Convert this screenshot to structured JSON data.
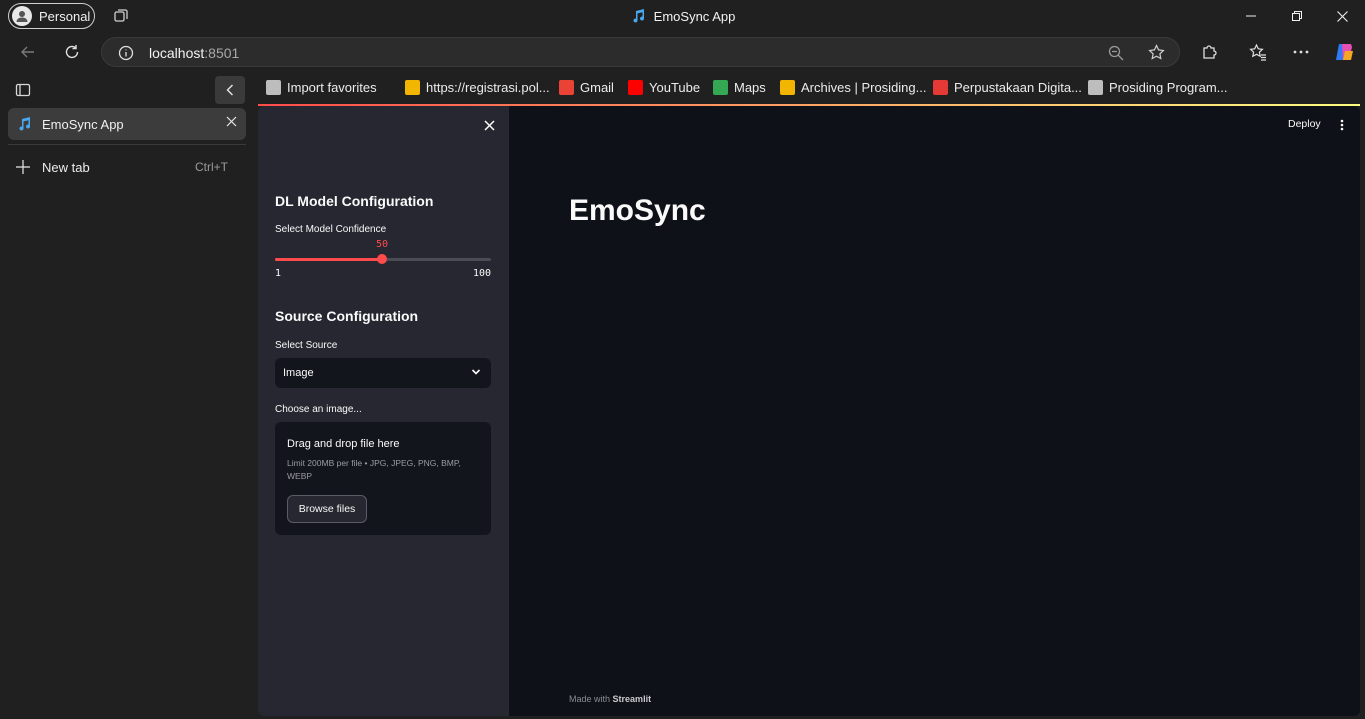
{
  "browser": {
    "profile_label": "Personal",
    "window_title": "EmoSync App",
    "url_host": "localhost",
    "url_port": ":8501"
  },
  "favorites": [
    {
      "label": "Import favorites",
      "icon": "import-icon",
      "color": "#bdbdbd"
    },
    {
      "label": "https://registrasi.pol...",
      "icon": "site-icon",
      "color": "#f2b600"
    },
    {
      "label": "Gmail",
      "icon": "gmail-icon",
      "color": "#ea4335"
    },
    {
      "label": "YouTube",
      "icon": "youtube-icon",
      "color": "#ff0000"
    },
    {
      "label": "Maps",
      "icon": "maps-icon",
      "color": "#34a853"
    },
    {
      "label": "Archives | Prosiding...",
      "icon": "site-icon",
      "color": "#f2b600"
    },
    {
      "label": "Perpustakaan Digita...",
      "icon": "library-icon",
      "color": "#e53935"
    },
    {
      "label": "Prosiding Program...",
      "icon": "page-icon",
      "color": "#bdbdbd"
    }
  ],
  "tabs": {
    "active_label": "EmoSync App",
    "new_tab_label": "New tab",
    "new_tab_shortcut": "Ctrl+T"
  },
  "sidebar": {
    "dl_heading": "DL Model Configuration",
    "slider_label": "Select Model Confidence",
    "slider_value": 50,
    "slider_min": "1",
    "slider_max": "100",
    "source_heading": "Source Configuration",
    "select_label": "Select Source",
    "select_value": "Image",
    "uploader_label": "Choose an image...",
    "uploader_title": "Drag and drop file here",
    "uploader_hint": "Limit 200MB per file • JPG, JPEG, PNG, BMP, WEBP",
    "browse_button": "Browse files"
  },
  "main": {
    "title": "EmoSync",
    "deploy_label": "Deploy",
    "footer_prefix": "Made with",
    "footer_brand": "Streamlit"
  },
  "colors": {
    "accent": "#ff4b4b",
    "app_bg": "#0e1117",
    "sidebar_bg": "#262730"
  }
}
